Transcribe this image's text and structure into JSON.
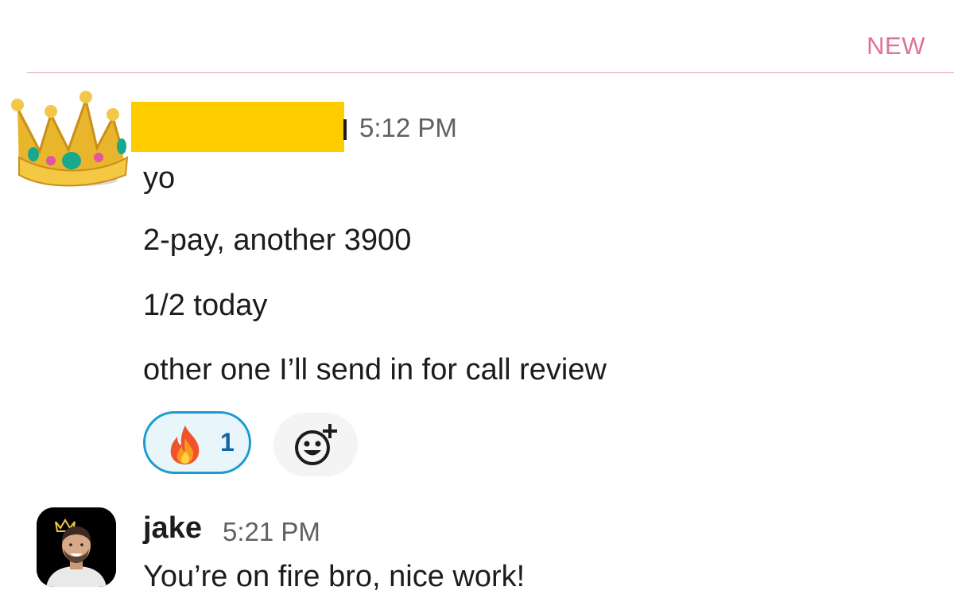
{
  "divider": {
    "label": "NEW",
    "color": "#e0719a"
  },
  "messages": [
    {
      "avatar_icon": "crown-icon",
      "author_redacted": true,
      "timestamp": "5:12 PM",
      "lines": [
        "yo",
        "2-pay, another 3900",
        "1/2 today",
        "other one I’ll send in for call review"
      ],
      "reactions": [
        {
          "icon": "fire-icon",
          "count": "1"
        }
      ],
      "add_reaction_icon": "add-emoji-icon"
    },
    {
      "avatar_icon": "profile-photo",
      "author": "jake",
      "timestamp": "5:21 PM",
      "lines": [
        "You’re on fire bro, nice work!"
      ]
    }
  ],
  "colors": {
    "redaction": "#ffcc00",
    "reaction_border": "#1d9bd1",
    "reaction_count": "#1264a3",
    "timestamp": "#616061"
  }
}
